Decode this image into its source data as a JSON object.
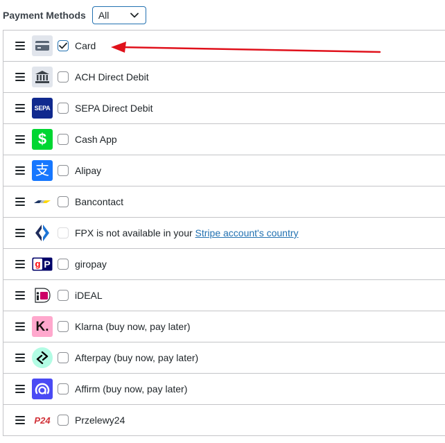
{
  "header": {
    "title": "Payment Methods",
    "filter_value": "All"
  },
  "methods": [
    {
      "label": "Card",
      "icon": "card-icon",
      "checked": true
    },
    {
      "label": "ACH Direct Debit",
      "icon": "bank-icon",
      "checked": false
    },
    {
      "label": "SEPA Direct Debit",
      "icon": "sepa-logo-icon",
      "checked": false
    },
    {
      "label": "Cash App",
      "icon": "cash-app-icon",
      "checked": false
    },
    {
      "label": "Alipay",
      "icon": "alipay-icon",
      "checked": false
    },
    {
      "label": "Bancontact",
      "icon": "bancontact-icon",
      "checked": false
    },
    {
      "label": "FPX is not available in your ",
      "link": "Stripe account's country",
      "icon": "fpx-icon",
      "checked": false,
      "disabled": true
    },
    {
      "label": "giropay",
      "icon": "giropay-icon",
      "checked": false
    },
    {
      "label": "iDEAL",
      "icon": "ideal-icon",
      "checked": false
    },
    {
      "label": "Klarna (buy now, pay later)",
      "icon": "klarna-icon",
      "checked": false
    },
    {
      "label": "Afterpay (buy now, pay later)",
      "icon": "afterpay-icon",
      "checked": false
    },
    {
      "label": "Affirm (buy now, pay later)",
      "icon": "affirm-icon",
      "checked": false
    },
    {
      "label": "Przelewy24",
      "icon": "przelewy24-icon",
      "checked": false
    }
  ],
  "logo_text": {
    "sepa": "SEPA",
    "cash_app": "$",
    "alipay": "支",
    "klarna": "K.",
    "p24": "P24"
  },
  "colors": {
    "accent": "#2271b1",
    "annotation_arrow": "#e0111b",
    "sepa_bg": "#10298e",
    "cash_app_bg": "#00d632",
    "alipay_bg": "#1677ff",
    "klarna_bg": "#ffa8cd",
    "afterpay_bg": "#b2fce4",
    "affirm_bg": "#4a4af4"
  }
}
